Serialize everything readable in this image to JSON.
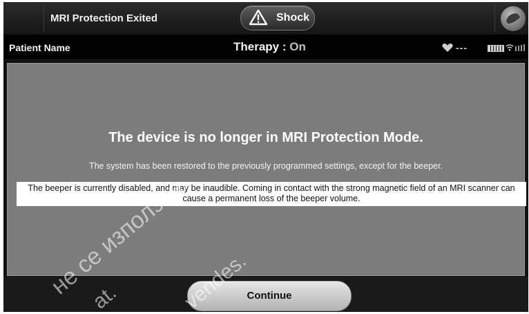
{
  "header": {
    "title": "MRI Protection Exited",
    "shock_label": "Shock"
  },
  "status_bar": {
    "patient_label": "Patient Name",
    "therapy_label": "Therapy :",
    "therapy_value": "On",
    "heart_rate": "---"
  },
  "dialog": {
    "headline": "The device is no longer in MRI Protection Mode.",
    "message": "The system has been restored to the previously programmed settings, except for the beeper.",
    "warning": "The beeper is currently disabled, and may be inaudible. Coming in contact with the strong magnetic field of an MRI scanner can cause a permanent loss of the beeper volume."
  },
  "footer": {
    "continue_label": "Continue"
  },
  "watermark": {
    "line1": "не се използва.",
    "line2": "at.",
    "line3": "vendes."
  }
}
